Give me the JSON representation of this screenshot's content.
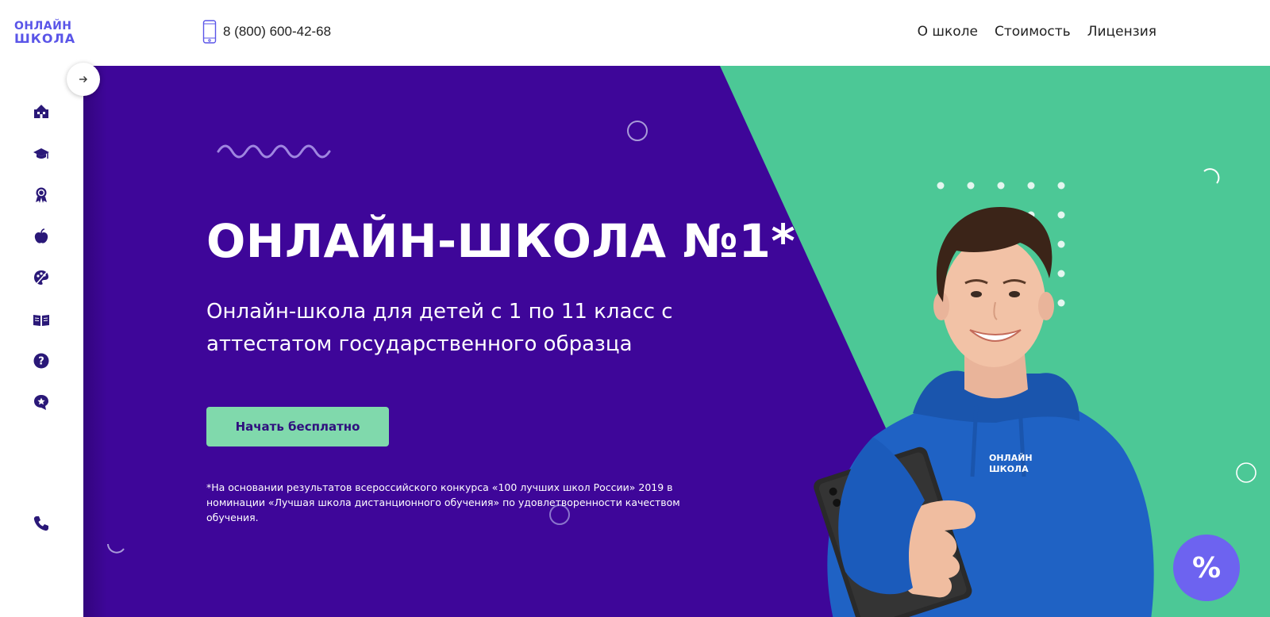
{
  "logo": {
    "line1": "ОНЛАЙН",
    "line2": "ШКОЛА"
  },
  "header": {
    "phone": "8 (800) 600-42-68",
    "nav": [
      {
        "label": "О школе"
      },
      {
        "label": "Стоимость"
      },
      {
        "label": "Лицензия"
      }
    ]
  },
  "sidebar": {
    "toggle_icon": "arrow-right-icon",
    "items": [
      {
        "icon": "school-building-icon"
      },
      {
        "icon": "graduation-cap-icon"
      },
      {
        "icon": "award-medal-icon"
      },
      {
        "icon": "apple-icon"
      },
      {
        "icon": "palette-icon"
      },
      {
        "icon": "open-book-icon"
      },
      {
        "icon": "question-icon"
      },
      {
        "icon": "star-chat-icon"
      }
    ],
    "phone_icon": "phone-icon"
  },
  "hero": {
    "title": "ОНЛАЙН-ШКОЛА №1*",
    "subtitle": "Онлайн-школа для детей с 1 по 11 класс с аттестатом государственного образца",
    "cta_label": "Начать бесплатно",
    "footnote": "*На основании результатов всероссийского конкурса «100 лучших школ России» 2019 в номинации «Лучшая школа дистанционного обучения» по удовлетворенности качеством обучения.",
    "hoodie_logo": {
      "line1": "ОНЛАЙН",
      "line2": "ШКОЛА"
    }
  },
  "discount_badge": {
    "label": "%"
  },
  "colors": {
    "purple": "#3e0699",
    "green": "#4cc896",
    "cta": "#80d9ac",
    "accent": "#5a55e8",
    "sidebar_icon": "#2a1878"
  }
}
